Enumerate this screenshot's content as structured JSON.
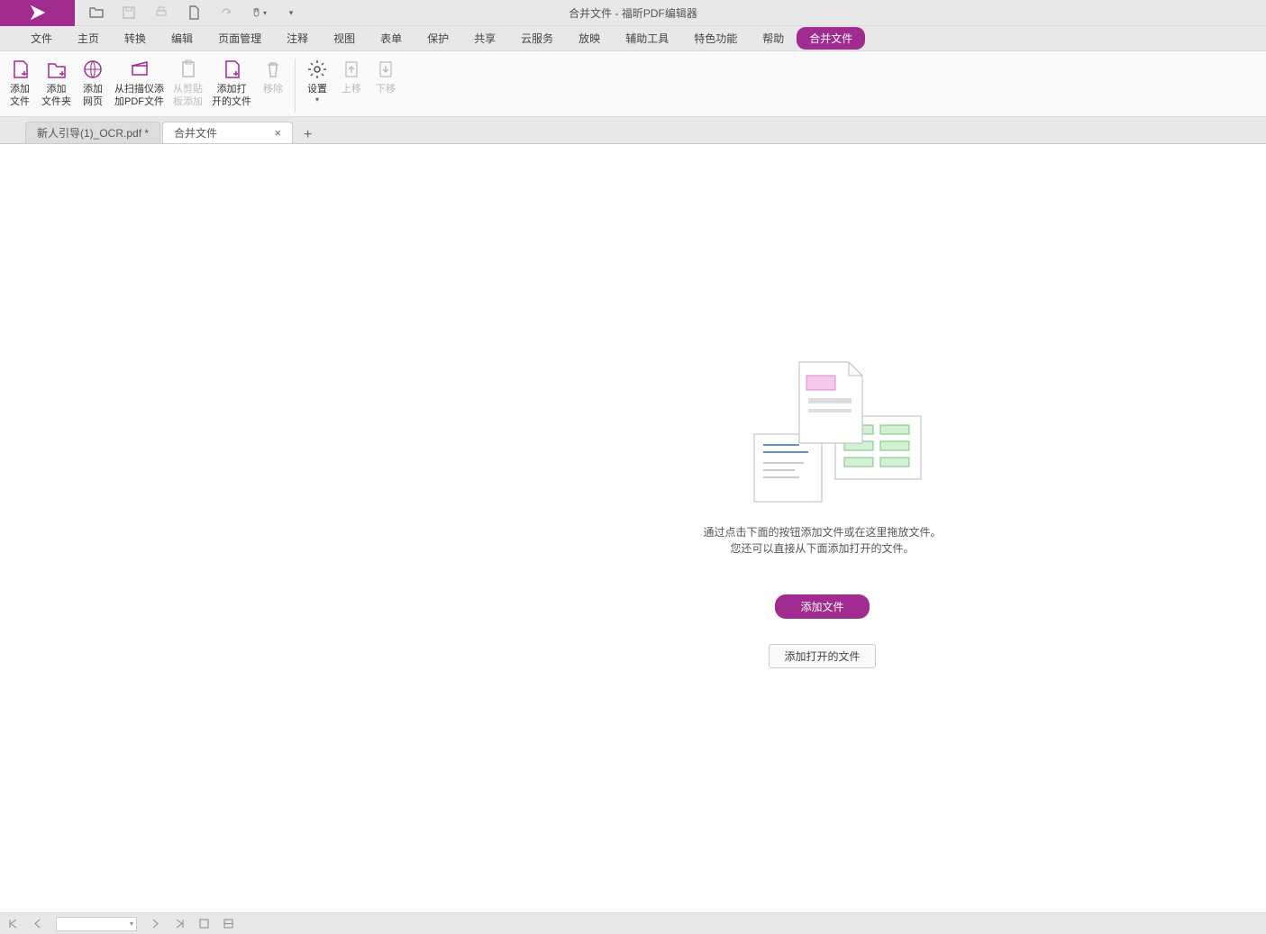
{
  "title": "合并文件 - 福昕PDF编辑器",
  "menu": [
    "文件",
    "主页",
    "转换",
    "编辑",
    "页面管理",
    "注释",
    "视图",
    "表单",
    "保护",
    "共享",
    "云服务",
    "放映",
    "辅助工具",
    "特色功能",
    "帮助",
    "合并文件"
  ],
  "menu_active": 15,
  "ribbon": [
    {
      "key": "add-file",
      "label": "添加\n文件",
      "disabled": false
    },
    {
      "key": "add-folder",
      "label": "添加\n文件夹",
      "disabled": false
    },
    {
      "key": "add-web",
      "label": "添加\n网页",
      "disabled": false
    },
    {
      "key": "add-scanner",
      "label": "从扫描仪添\n加PDF文件",
      "disabled": false
    },
    {
      "key": "add-clipboard",
      "label": "从剪贴\n板添加",
      "disabled": true
    },
    {
      "key": "add-open",
      "label": "添加打\n开的文件",
      "disabled": false
    },
    {
      "key": "remove",
      "label": "移除",
      "disabled": true
    },
    {
      "sep": true
    },
    {
      "key": "settings",
      "label": "设置",
      "disabled": false,
      "drop": true
    },
    {
      "key": "move-up",
      "label": "上移",
      "disabled": true
    },
    {
      "key": "move-down",
      "label": "下移",
      "disabled": true
    }
  ],
  "tabs": [
    {
      "label": "新人引导(1)_OCR.pdf *",
      "active": false
    },
    {
      "label": "合并文件",
      "active": true
    }
  ],
  "empty": {
    "hint1": "通过点击下面的按钮添加文件或在这里拖放文件。",
    "hint2": "您还可以直接从下面添加打开的文件。",
    "add_btn": "添加文件",
    "open_btn": "添加打开的文件"
  }
}
